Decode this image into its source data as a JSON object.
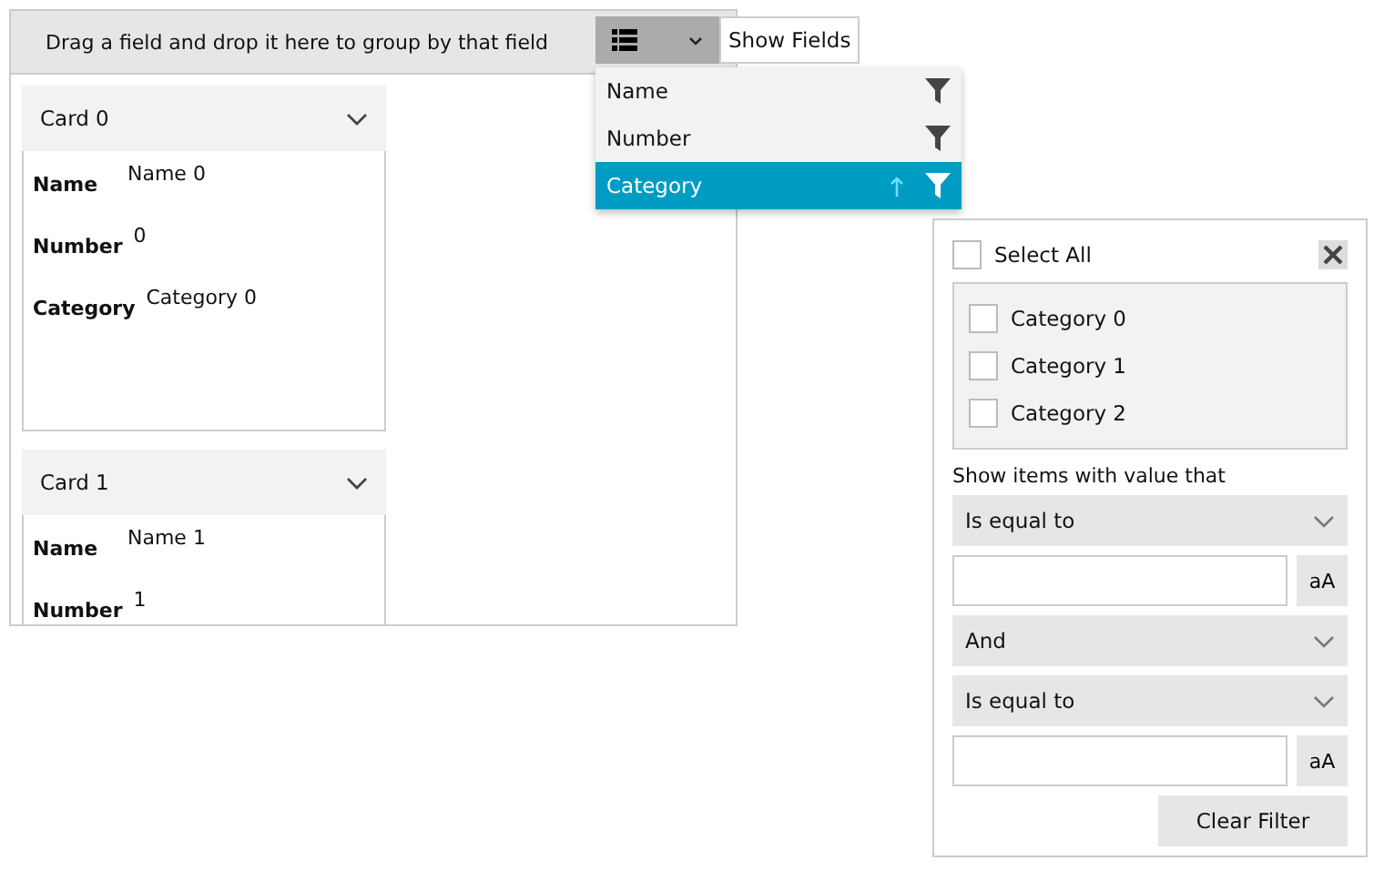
{
  "group_panel": {
    "hint": "Drag a field and drop it here to group by that field",
    "show_fields_label": "Show Fields"
  },
  "fields": [
    {
      "label": "Name",
      "selected": false,
      "sorted": false
    },
    {
      "label": "Number",
      "selected": false,
      "sorted": false
    },
    {
      "label": "Category",
      "selected": true,
      "sorted": true
    }
  ],
  "cards": [
    {
      "title": "Card 0",
      "rows": [
        {
          "label": "Name",
          "value": "Name 0"
        },
        {
          "label": "Number",
          "value": "0"
        },
        {
          "label": "Category",
          "value": "Category 0"
        }
      ]
    },
    {
      "title": "Card 1",
      "rows": [
        {
          "label": "Name",
          "value": "Name 1"
        },
        {
          "label": "Number",
          "value": "1"
        }
      ]
    }
  ],
  "filter": {
    "select_all": {
      "label": "Select All",
      "checked": false
    },
    "values": [
      {
        "label": "Category 0",
        "checked": false
      },
      {
        "label": "Category 1",
        "checked": false
      },
      {
        "label": "Category 2",
        "checked": false
      }
    ],
    "condition_caption": "Show items with value that",
    "controls": [
      {
        "kind": "dropdown",
        "value": "Is equal to"
      },
      {
        "kind": "input",
        "case_label": "aA"
      },
      {
        "kind": "dropdown",
        "value": "And"
      },
      {
        "kind": "dropdown",
        "value": "Is equal to"
      },
      {
        "kind": "input",
        "case_label": "aA"
      }
    ],
    "clear_label": "Clear Filter"
  }
}
